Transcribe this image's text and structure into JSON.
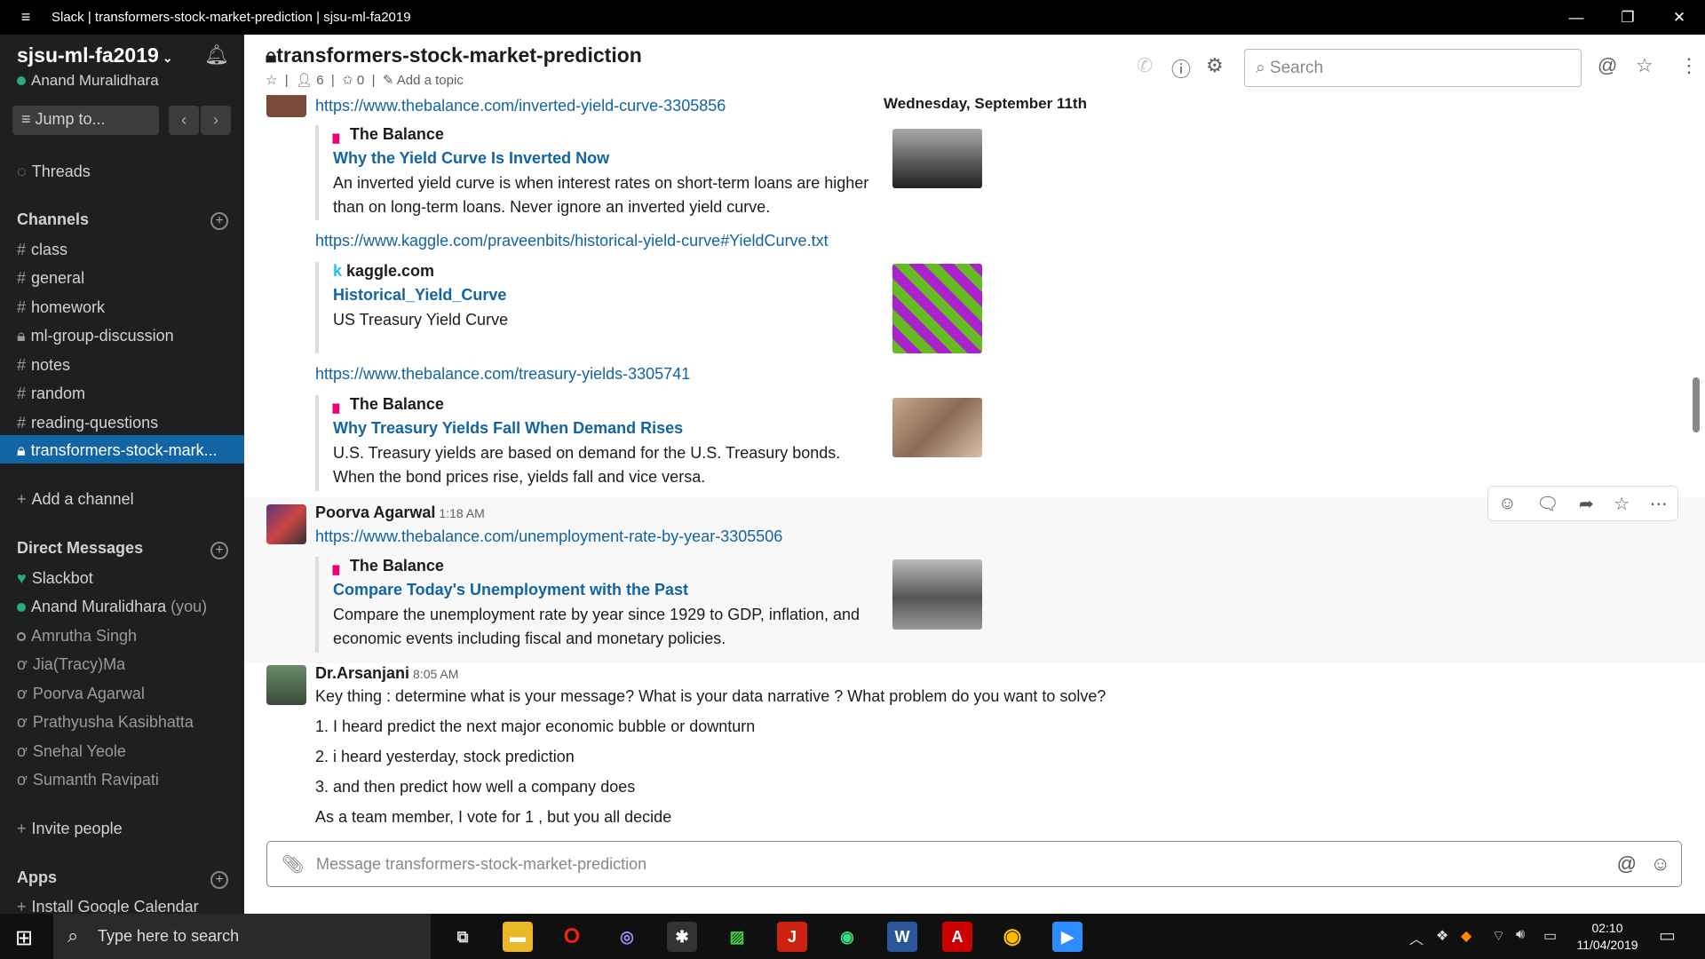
{
  "window": {
    "title": "Slack | transformers-stock-market-prediction | sjsu-ml-fa2019",
    "menu_icon": "≡",
    "minimize": "—",
    "maximize": "❐",
    "close": "✕"
  },
  "sidebar": {
    "workspace": "sjsu-ml-fa2019",
    "user": "Anand Muralidhara",
    "jump_to": "Jump to...",
    "threads": "Threads",
    "channels_header": "Channels",
    "channels": [
      "class",
      "general",
      "homework",
      "ml-group-discussion",
      "notes",
      "random",
      "reading-questions",
      "transformers-stock-mark..."
    ],
    "add_channel": "Add a channel",
    "dm_header": "Direct Messages",
    "dms": [
      "Slackbot",
      "Anand Muralidhara",
      "Amrutha Singh",
      "Jia(Tracy)Ma",
      "Poorva Agarwal",
      "Prathyusha Kasibhatta",
      "Snehal Yeole",
      "Sumanth Ravipati"
    ],
    "you_label": "(you)",
    "invite": "Invite people",
    "apps_header": "Apps",
    "install_app": "Install Google Calendar"
  },
  "header": {
    "channel": "transformers-stock-market-prediction",
    "members": "6",
    "pinned": "0",
    "add_topic": "Add a topic",
    "search_placeholder": "Search"
  },
  "messages": {
    "date_divider": "Wednesday, September 11th",
    "link1": "https://www.thebalance.com/inverted-yield-curve-3305856",
    "unfurl1": {
      "site": "The Balance",
      "title": "Why the Yield Curve Is Inverted Now",
      "desc": "An inverted yield curve is when interest rates on short-term loans are higher than on long-term loans. Never ignore an inverted yield curve."
    },
    "link2": "https://www.kaggle.com/praveenbits/historical-yield-curve#YieldCurve.txt",
    "unfurl2": {
      "site": "kaggle.com",
      "title": "Historical_Yield_Curve",
      "desc": "US Treasury Yield Curve"
    },
    "link3": "https://www.thebalance.com/treasury-yields-3305741",
    "unfurl3": {
      "site": "The Balance",
      "title": "Why Treasury Yields Fall When Demand Rises",
      "desc": "U.S. Treasury yields are based on demand for the U.S. Treasury bonds. When the bond prices rise, yields fall and vice versa."
    },
    "msg2": {
      "author": "Poorva Agarwal",
      "time": "1:18 AM",
      "link": "https://www.thebalance.com/unemployment-rate-by-year-3305506"
    },
    "unfurl4": {
      "site": "The Balance",
      "title": "Compare Today's Unemployment with the Past",
      "desc": "Compare the unemployment rate by year since 1929 to GDP, inflation, and economic events including fiscal and monetary policies."
    },
    "msg3": {
      "author": "Dr.Arsanjani",
      "time": "8:05 AM",
      "lines": [
        "Key thing : determine what is your message? What is your data narrative ? What problem do you want to solve?",
        "1. I heard predict the next major economic bubble or downturn",
        "2. i heard yesterday, stock prediction",
        "3. and then predict how well a company does",
        "As a team member, I vote for 1 , but you all decide"
      ]
    }
  },
  "composer": {
    "placeholder": "Message transformers-stock-market-prediction"
  },
  "taskbar": {
    "search": "Type here to search",
    "time": "02:10",
    "date": "11/04/2019"
  },
  "colors": {
    "sidebar_bg": "#1e1f21",
    "active_channel": "#1264a3",
    "link": "#1264a3",
    "presence_green": "#2bac76"
  }
}
